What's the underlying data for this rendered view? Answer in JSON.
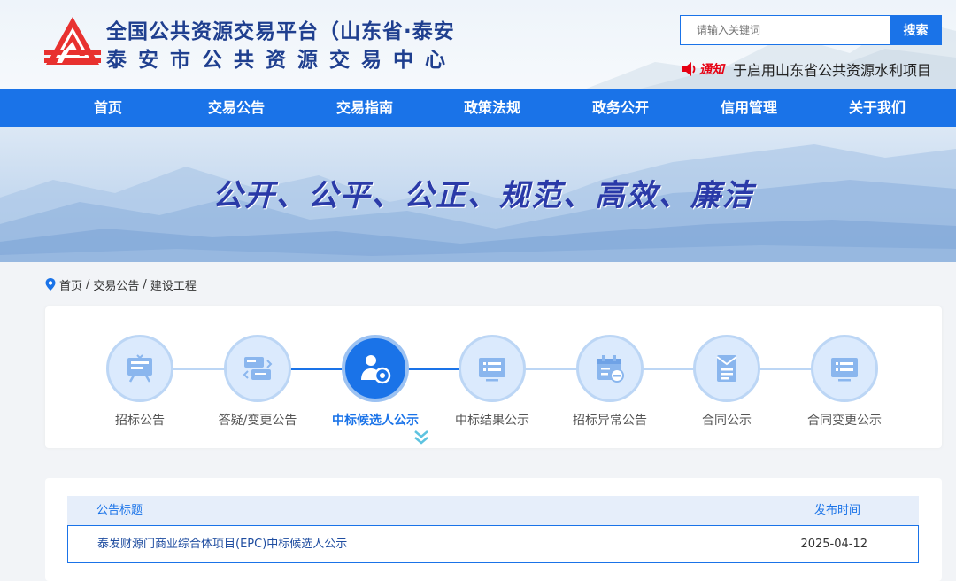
{
  "header": {
    "title": "全国公共资源交易平台（山东省·泰安",
    "subtitle": "泰安市公共资源交易中心",
    "search": {
      "placeholder": "请输入关键词",
      "button_label": "搜索"
    },
    "notice": {
      "tag": "通知",
      "text": "于启用山东省公共资源水利项目"
    }
  },
  "nav": {
    "items": [
      {
        "label": "首页"
      },
      {
        "label": "交易公告"
      },
      {
        "label": "交易指南"
      },
      {
        "label": "政策法规"
      },
      {
        "label": "政务公开"
      },
      {
        "label": "信用管理"
      },
      {
        "label": "关于我们"
      }
    ]
  },
  "banner": {
    "slogan": "公开、公平、公正、规范、高效、廉洁"
  },
  "breadcrumb": {
    "items": [
      "首页",
      "交易公告",
      "建设工程"
    ],
    "separator": "/"
  },
  "steps": {
    "active_index": 2,
    "items": [
      {
        "label": "招标公告",
        "icon": "monitor-icon"
      },
      {
        "label": "答疑/变更公告",
        "icon": "exchange-cards-icon"
      },
      {
        "label": "中标候选人公示",
        "icon": "candidate-person-icon"
      },
      {
        "label": "中标结果公示",
        "icon": "result-screen-icon"
      },
      {
        "label": "招标异常公告",
        "icon": "calendar-exception-icon"
      },
      {
        "label": "合同公示",
        "icon": "contract-document-icon"
      },
      {
        "label": "合同变更公示",
        "icon": "contract-change-screen-icon"
      }
    ]
  },
  "table": {
    "columns": {
      "title": "公告标题",
      "date": "发布时间"
    },
    "rows": [
      {
        "title": "泰发财源门商业综合体项目(EPC)中标候选人公示",
        "date": "2025-04-12"
      }
    ]
  },
  "colors": {
    "primary": "#1a73e8",
    "title_navy": "#1f3f8f",
    "notice_red": "#e60012",
    "slogan": "#2a3aa8"
  }
}
